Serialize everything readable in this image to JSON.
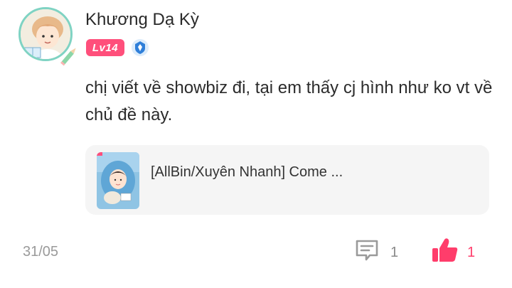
{
  "user": {
    "name": "Khương Dạ Kỳ",
    "level": "Lv14"
  },
  "comment": {
    "text": "chị viết về showbiz đi, tại em thấy cj hình như ko vt về chủ đề này."
  },
  "story": {
    "title": "[AllBin/Xuyên Nhanh] Come ..."
  },
  "footer": {
    "date": "31/05",
    "comment_count": "1",
    "like_count": "1"
  },
  "colors": {
    "level_badge": "#ff4f7b",
    "like_accent": "#ff3d6b",
    "avatar_ring": "#7fd3c3",
    "verify_blue": "#2f7fd9"
  },
  "icons": {
    "verify": "verified-shield-icon",
    "comment": "comment-bubble-icon",
    "like": "thumbs-up-icon"
  }
}
